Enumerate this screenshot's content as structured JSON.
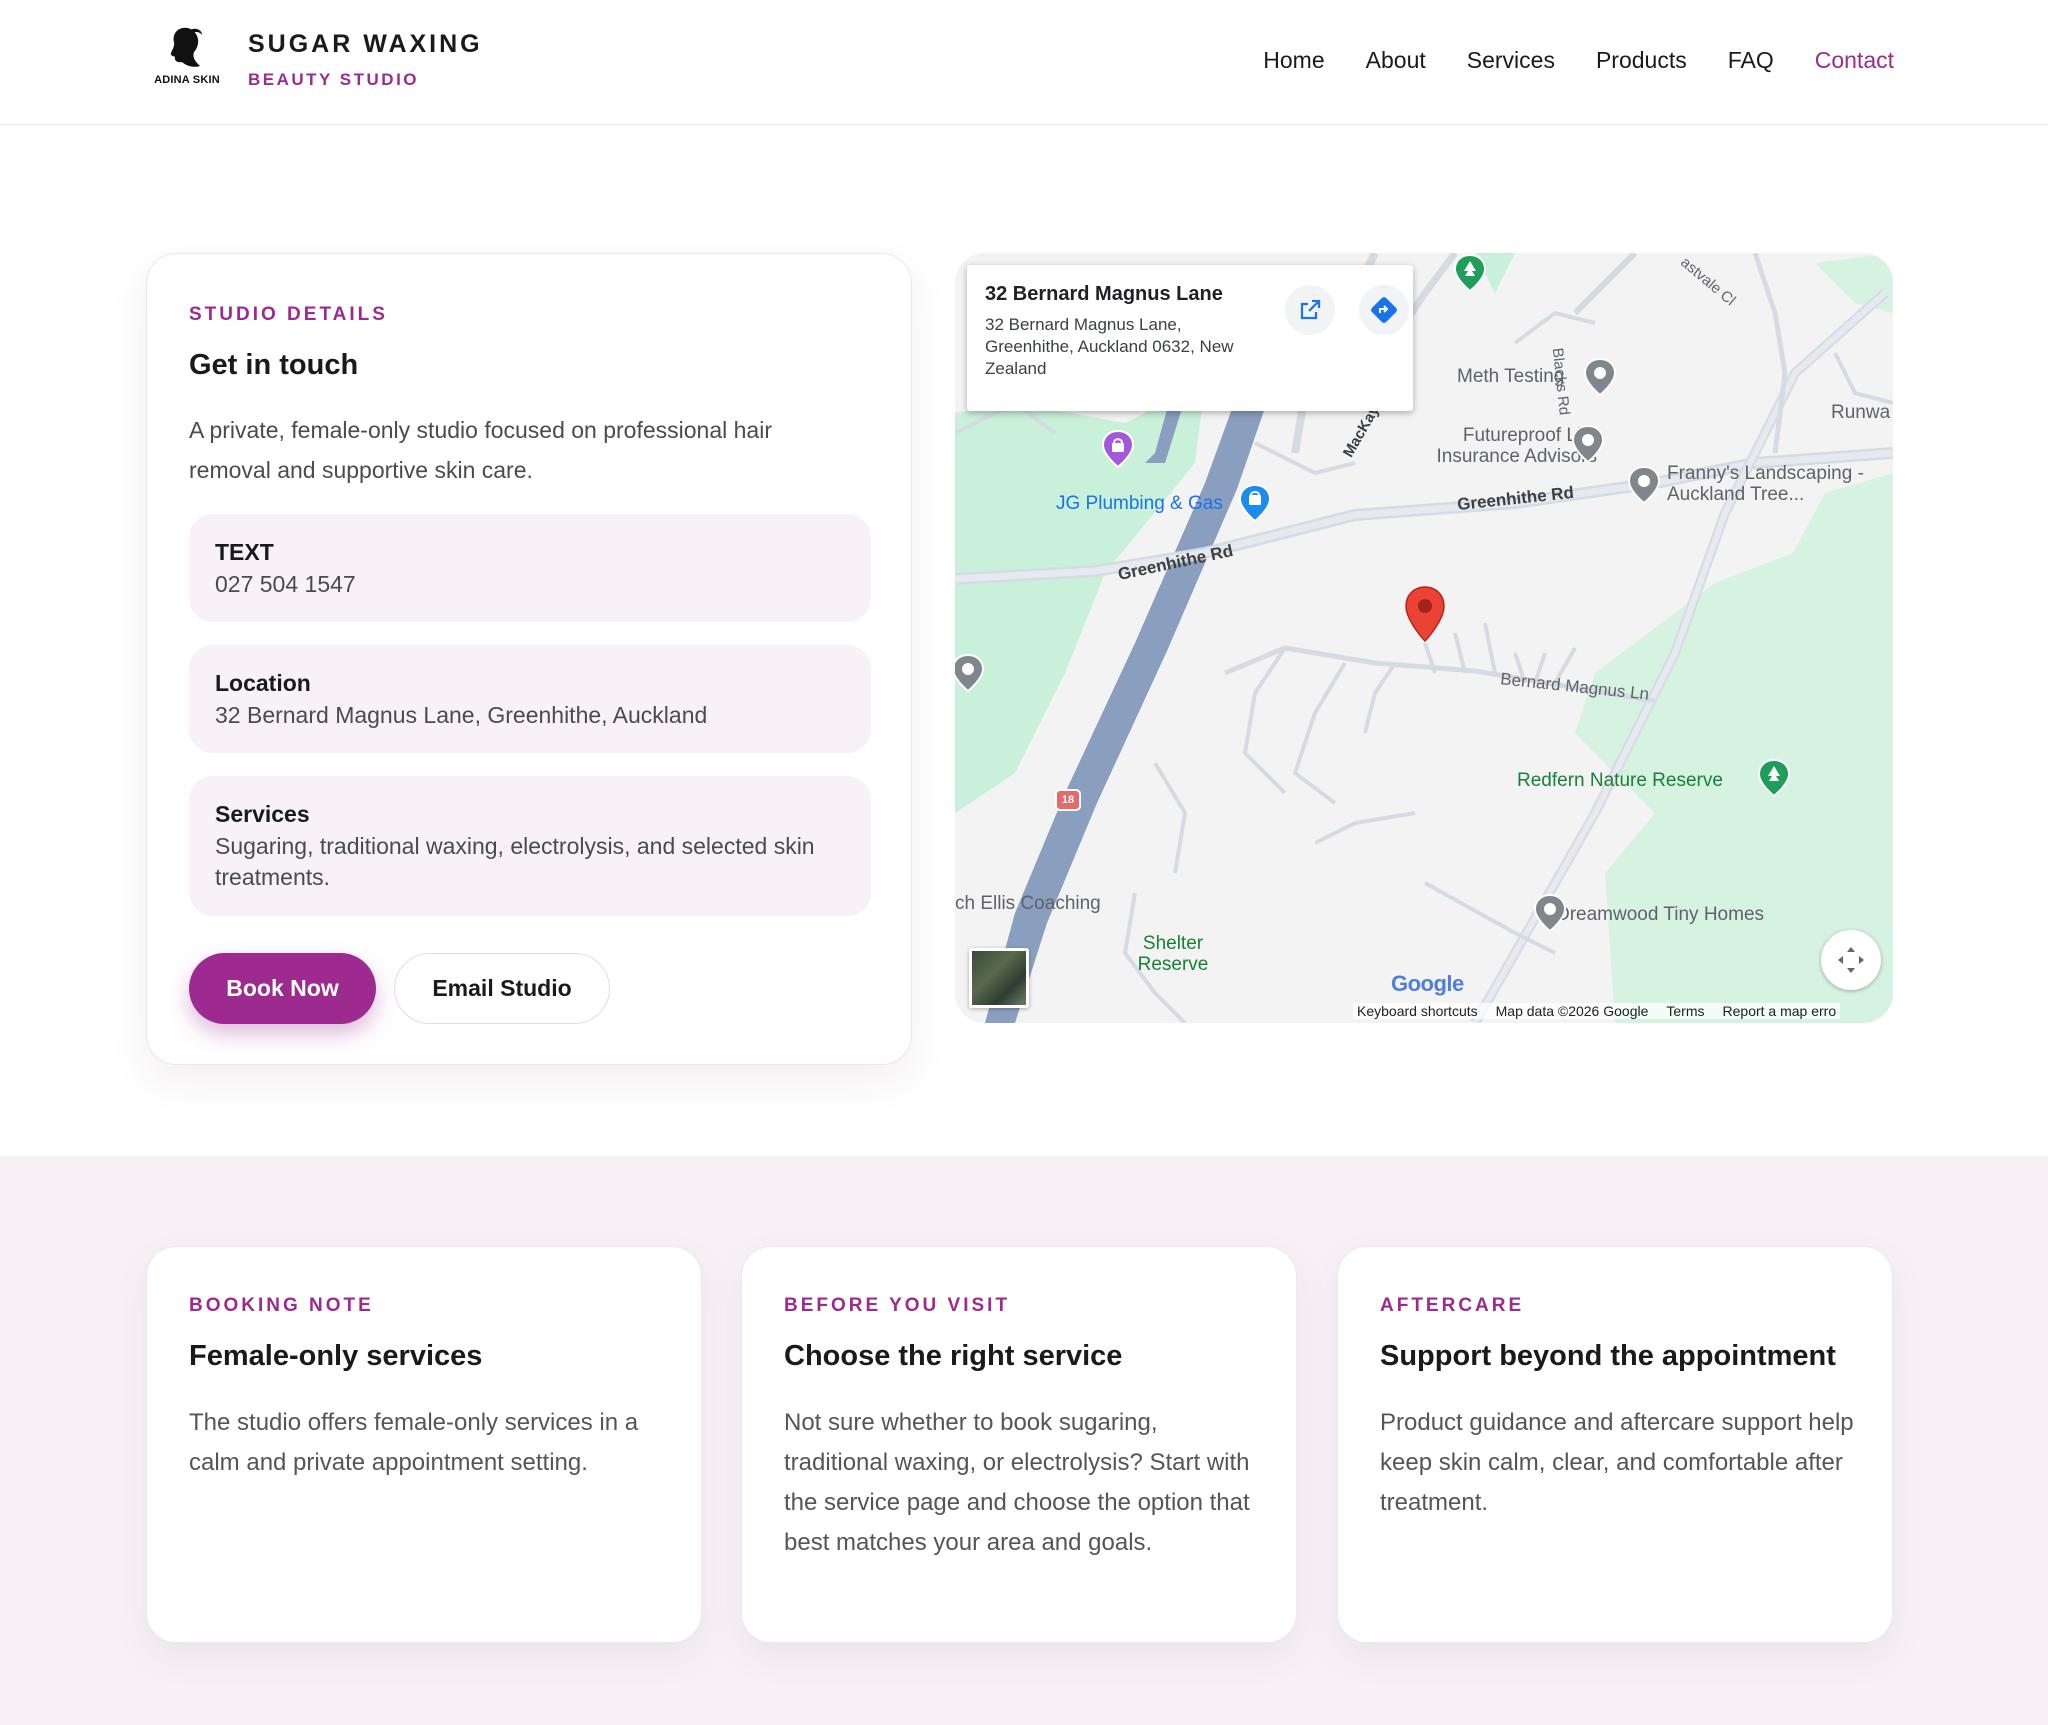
{
  "header": {
    "logo_caption": "ADINA SKIN",
    "brand_title": "SUGAR WAXING",
    "brand_subtitle": "BEAUTY STUDIO",
    "nav": [
      "Home",
      "About",
      "Services",
      "Products",
      "FAQ",
      "Contact"
    ],
    "active_nav": "Contact"
  },
  "details": {
    "eyebrow": "STUDIO DETAILS",
    "heading": "Get in touch",
    "intro": "A private, female-only studio focused on professional hair removal and supportive skin care.",
    "items": [
      {
        "label": "TEXT",
        "value": "027 504 1547"
      },
      {
        "label": "Location",
        "value": "32 Bernard Magnus Lane, Greenhithe, Auckland"
      },
      {
        "label": "Services",
        "value": "Sugaring, traditional waxing, electrolysis, and selected skin treatments."
      }
    ],
    "book_label": "Book Now",
    "email_label": "Email Studio"
  },
  "map": {
    "info_title": "32 Bernard Magnus Lane",
    "info_address": "32 Bernard Magnus Lane, Greenhithe, Auckland 0632, New Zealand",
    "pois": {
      "meth_testing": "Meth Testing",
      "futureproof": "Futureproof Life Insurance Advisors",
      "frannys": "Franny's Landscaping - Auckland Tree...",
      "jg_plumbing": "JG Plumbing & Gas",
      "redfern": "Redfern Nature Reserve",
      "dreamwood": "Dreamwood Tiny Homes",
      "shelter_reserve": "Shelter Reserve",
      "ellis_coaching": "ch Ellis Coaching",
      "runwa": "Runwa"
    },
    "roads": {
      "greenhithe_west": "Greenhithe Rd",
      "greenhithe_east": "Greenhithe Rd",
      "bernard_magnus": "Bernard Magnus Ln",
      "blacks_rd": "Blacks Rd",
      "mackay": "MacKay",
      "eastvale": "astvale Cl",
      "highway_shield": "18"
    },
    "google": "Google",
    "footer": [
      "Keyboard shortcuts",
      "Map data ©2026 Google",
      "Terms",
      "Report a map erro"
    ]
  },
  "features": [
    {
      "eyebrow": "BOOKING NOTE",
      "heading": "Female-only services",
      "body": "The studio offers female-only services in a calm and private appointment setting."
    },
    {
      "eyebrow": "BEFORE YOU VISIT",
      "heading": "Choose the right service",
      "body": "Not sure whether to book sugaring, traditional waxing, or electrolysis? Start with the service page and choose the option that best matches your area and goals."
    },
    {
      "eyebrow": "AFTERCARE",
      "heading": "Support beyond the appointment",
      "body": "Product guidance and aftercare support help keep skin calm, clear, and comfortable after treatment."
    }
  ],
  "colors": {
    "accent": "#9c2a8f",
    "tint": "#f8f1f7",
    "band": "#f7f1f6"
  }
}
